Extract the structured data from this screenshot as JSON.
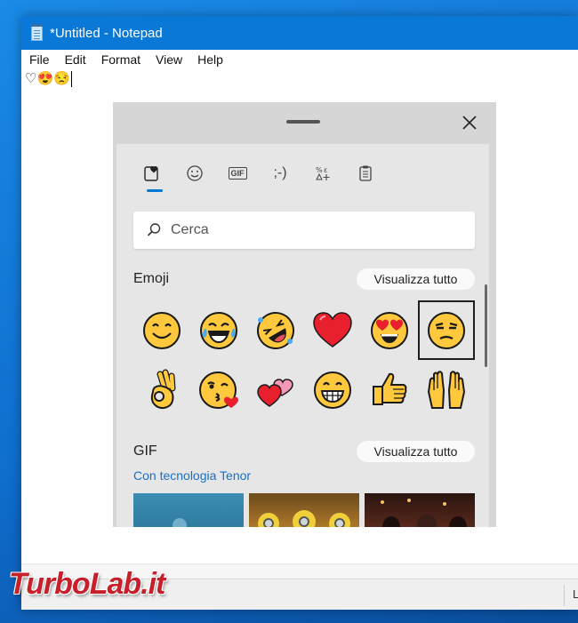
{
  "window": {
    "title": "*Untitled - Notepad"
  },
  "menu": [
    "File",
    "Edit",
    "Format",
    "View",
    "Help"
  ],
  "editor": {
    "content": "♡😍😒"
  },
  "statusbar": {
    "text": "L"
  },
  "watermark": "TurboLab.it",
  "emoji_panel": {
    "tabs": [
      {
        "name": "recently-used",
        "label": "",
        "active": true
      },
      {
        "name": "emoji",
        "label": ""
      },
      {
        "name": "gif",
        "label": "GIF"
      },
      {
        "name": "kaomoji",
        "label": ";-)"
      },
      {
        "name": "symbols",
        "label": ""
      },
      {
        "name": "clipboard",
        "label": ""
      }
    ],
    "search": {
      "placeholder": "Cerca",
      "value": ""
    },
    "emoji_section": {
      "title": "Emoji",
      "see_all": "Visualizza tutto"
    },
    "emojis": [
      {
        "name": "smiling-face",
        "char": "😊"
      },
      {
        "name": "tears-of-joy",
        "char": "😂"
      },
      {
        "name": "rofl",
        "char": "🤣"
      },
      {
        "name": "red-heart",
        "char": "❤️"
      },
      {
        "name": "heart-eyes",
        "char": "😍"
      },
      {
        "name": "unamused",
        "char": "😒",
        "selected": true
      },
      {
        "name": "ok-hand",
        "char": "👌"
      },
      {
        "name": "kissing-heart",
        "char": "😘"
      },
      {
        "name": "two-hearts",
        "char": "💕"
      },
      {
        "name": "grinning",
        "char": "😁"
      },
      {
        "name": "thumbs-up",
        "char": "👍"
      },
      {
        "name": "raising-hands",
        "char": "🙌"
      }
    ],
    "gif_section": {
      "title": "GIF",
      "see_all": "Visualizza tutto",
      "powered_by": "Con tecnologia Tenor"
    },
    "colors": {
      "accent": "#0078d4",
      "emoji_yellow": "#ffc83d",
      "heart_red": "#e8202e",
      "link": "#1a6fc7"
    }
  }
}
